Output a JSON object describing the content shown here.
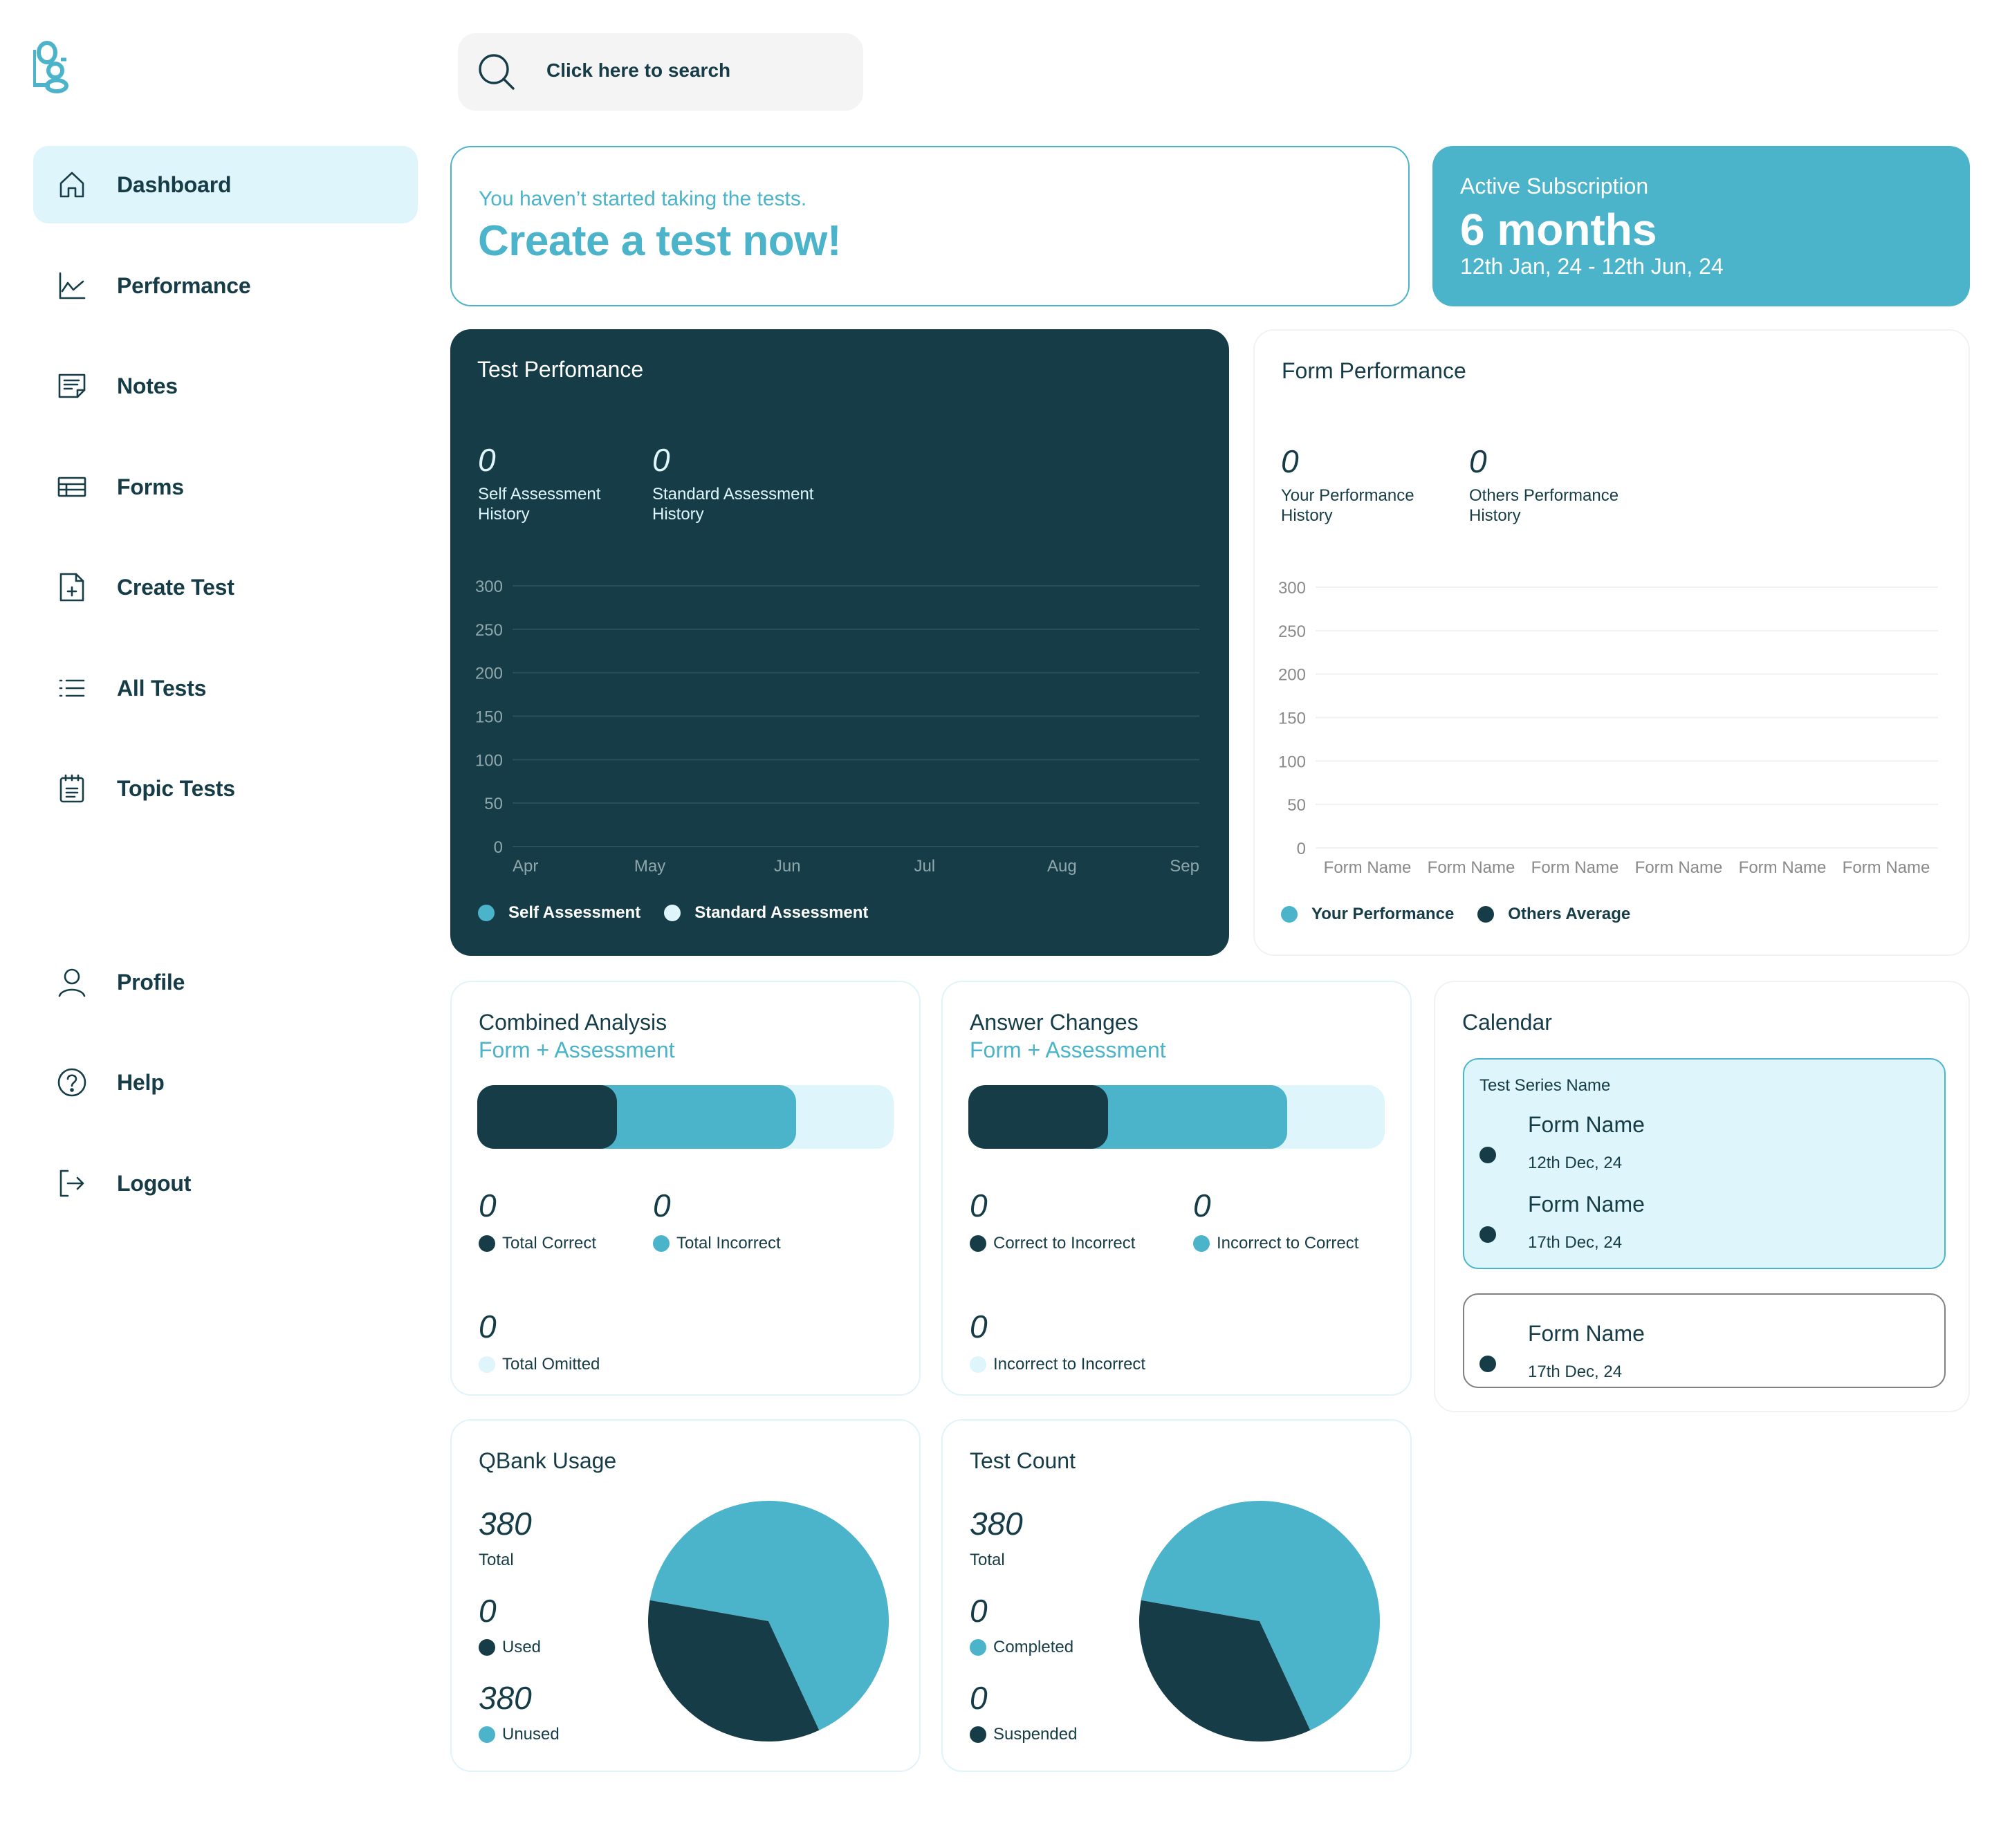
{
  "colors": {
    "dark": "#163d47",
    "accent": "#4bb4cb",
    "light": "#def5fb",
    "grid_dark": "#2a5059",
    "grid_light": "#f1f1f1",
    "tick_dark": "#8fa6ab",
    "tick_light": "#8a8a8a"
  },
  "logo": {
    "icon": "logo-og-mark"
  },
  "sidebar": {
    "items": [
      {
        "label": "Dashboard",
        "icon": "home-icon",
        "active": true
      },
      {
        "label": "Performance",
        "icon": "line-chart-icon"
      },
      {
        "label": "Notes",
        "icon": "note-icon"
      },
      {
        "label": "Forms",
        "icon": "table-icon"
      },
      {
        "label": "Create Test",
        "icon": "file-plus-icon"
      },
      {
        "label": "All Tests",
        "icon": "list-icon"
      },
      {
        "label": "Topic Tests",
        "icon": "calendar-list-icon"
      }
    ],
    "bottom_items": [
      {
        "label": "Profile",
        "icon": "user-icon"
      },
      {
        "label": "Help",
        "icon": "help-circle-icon"
      },
      {
        "label": "Logout",
        "icon": "logout-icon"
      }
    ]
  },
  "search": {
    "placeholder": "Click here to search",
    "icon": "search-icon"
  },
  "banner": {
    "subtitle": "You haven’t started taking the tests.",
    "headline": "Create a test now!"
  },
  "subscription": {
    "label": "Active Subscription",
    "value": "6 months",
    "range": "12th Jan, 24 - 12th Jun, 24"
  },
  "test_performance": {
    "title": "Test Perfomance",
    "stats": [
      {
        "value": "0",
        "label_line1": "Self Assessment",
        "label_line2": "History"
      },
      {
        "value": "0",
        "label_line1": "Standard Assessment",
        "label_line2": "History"
      }
    ]
  },
  "form_performance": {
    "title": "Form Performance",
    "stats": [
      {
        "value": "0",
        "label_line1": "Your Performance",
        "label_line2": "History"
      },
      {
        "value": "0",
        "label_line1": "Others Performance",
        "label_line2": "History"
      }
    ]
  },
  "combined_analysis": {
    "title": "Combined Analysis",
    "subtitle": "Form + Assessment",
    "bar": {
      "correct_fraction": 0.335,
      "incorrect_fraction": 0.43,
      "omitted_fraction": 0.235
    },
    "stats": [
      {
        "value": "0",
        "label": "Total Correct",
        "color": "dark"
      },
      {
        "value": "0",
        "label": "Total Incorrect",
        "color": "accent"
      },
      {
        "value": "0",
        "label": "Total Omitted",
        "color": "light"
      }
    ]
  },
  "answer_changes": {
    "title": "Answer Changes",
    "subtitle": "Form + Assessment",
    "bar": {
      "correct_fraction": 0.335,
      "incorrect_fraction": 0.43,
      "omitted_fraction": 0.235
    },
    "stats": [
      {
        "value": "0",
        "label": "Correct to Incorrect",
        "color": "dark"
      },
      {
        "value": "0",
        "label": "Incorrect to Correct",
        "color": "accent"
      },
      {
        "value": "0",
        "label": "Incorrect to Incorrect",
        "color": "light"
      }
    ]
  },
  "calendar": {
    "title": "Calendar",
    "groups": [
      {
        "series": "Test Series Name",
        "highlighted": true,
        "entries": [
          {
            "name": "Form Name",
            "date": "12th Dec, 24"
          },
          {
            "name": "Form Name",
            "date": "17th Dec, 24"
          }
        ]
      },
      {
        "series": "",
        "highlighted": false,
        "entries": [
          {
            "name": "Form Name",
            "date": "17th Dec, 24"
          }
        ]
      }
    ]
  },
  "qbank_usage": {
    "title": "QBank Usage",
    "stats": [
      {
        "value": "380",
        "label": "Total",
        "color": null
      },
      {
        "value": "0",
        "label": "Used",
        "color": "dark"
      },
      {
        "value": "380",
        "label": "Unused",
        "color": "accent"
      }
    ]
  },
  "test_count": {
    "title": "Test Count",
    "stats": [
      {
        "value": "380",
        "label": "Total",
        "color": null
      },
      {
        "value": "0",
        "label": "Completed",
        "color": "accent"
      },
      {
        "value": "0",
        "label": "Suspended",
        "color": "dark"
      }
    ]
  },
  "chart_data": [
    {
      "type": "line",
      "title": "Test Perfomance",
      "categories": [
        "Apr",
        "May",
        "Jun",
        "Jul",
        "Aug",
        "Sep"
      ],
      "series": [
        {
          "name": "Self Assessment",
          "color": "#4bb4cb",
          "values": []
        },
        {
          "name": "Standard Assessment",
          "color": "#def5fb",
          "values": []
        }
      ],
      "yticks": [
        0,
        50,
        100,
        150,
        200,
        250,
        300
      ],
      "ylim": [
        0,
        300
      ],
      "grid": true,
      "legend": "bottom-left",
      "xlabel": "",
      "ylabel": ""
    },
    {
      "type": "bar",
      "title": "Form Performance",
      "categories": [
        "Form Name",
        "Form Name",
        "Form Name",
        "Form Name",
        "Form Name",
        "Form Name"
      ],
      "series": [
        {
          "name": "Your Performance",
          "color": "#4bb4cb",
          "values": []
        },
        {
          "name": "Others Average",
          "color": "#163d47",
          "values": []
        }
      ],
      "yticks": [
        0,
        50,
        100,
        150,
        200,
        250,
        300
      ],
      "ylim": [
        0,
        300
      ],
      "grid": true,
      "legend": "bottom-left",
      "xlabel": "",
      "ylabel": ""
    },
    {
      "type": "pie",
      "title": "QBank Usage",
      "slices": [
        {
          "name": "Unused",
          "color": "#4bb4cb",
          "fraction": 0.653
        },
        {
          "name": "Used",
          "color": "#163d47",
          "fraction": 0.347
        }
      ]
    },
    {
      "type": "pie",
      "title": "Test Count",
      "slices": [
        {
          "name": "Completed",
          "color": "#4bb4cb",
          "fraction": 0.653
        },
        {
          "name": "Suspended",
          "color": "#163d47",
          "fraction": 0.347
        }
      ]
    }
  ]
}
